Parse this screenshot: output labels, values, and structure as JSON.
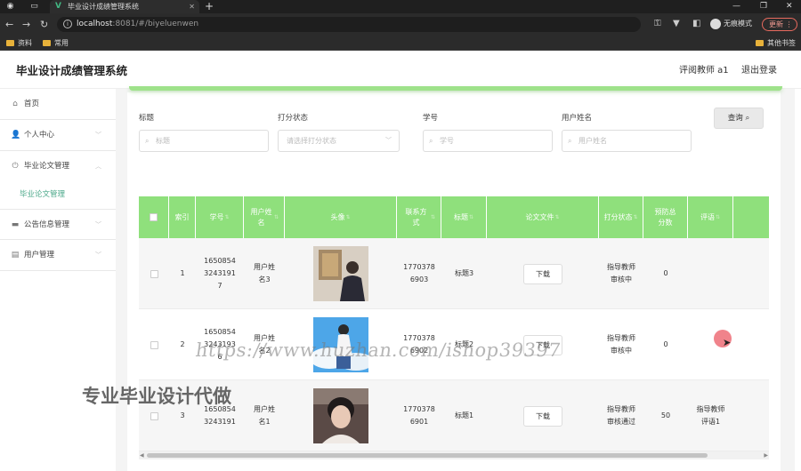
{
  "browser": {
    "tab_title": "毕业设计成绩管理系统",
    "url_host": "localhost",
    "url_rest": ":8081/#/biyeluenwen",
    "incognito_label": "无痕模式",
    "update_label": "更新",
    "bookmarks": [
      "资料",
      "常用"
    ],
    "other_bookmarks": "其他书签"
  },
  "header": {
    "title": "毕业设计成绩管理系统",
    "user": "评阅教师 a1",
    "logout": "退出登录"
  },
  "sidebar": {
    "items": [
      {
        "label": "首页",
        "icon": "home-icon"
      },
      {
        "label": "个人中心",
        "icon": "user-icon"
      },
      {
        "label": "毕业论文管理",
        "icon": "power-icon"
      },
      {
        "label": "公告信息管理",
        "icon": "monitor-icon"
      },
      {
        "label": "用户管理",
        "icon": "clipboard-icon"
      }
    ],
    "active_sub": "毕业论文管理"
  },
  "filters": {
    "title_label": "标题",
    "title_placeholder": "标题",
    "status_label": "打分状态",
    "status_placeholder": "请选择打分状态",
    "student_label": "学号",
    "student_placeholder": "学号",
    "name_label": "用户姓名",
    "name_placeholder": "用户姓名",
    "query_label": "查询"
  },
  "table": {
    "headers": [
      "索引",
      "学号",
      "用户姓名",
      "头像",
      "联系方式",
      "标题",
      "论文文件",
      "打分状态",
      "预防总分数",
      "评语"
    ],
    "download_label": "下载",
    "rows": [
      {
        "index": "1",
        "student_id": "16508543243191 7",
        "name": "用户姓名3",
        "phone": "17703786903",
        "title": "标题3",
        "status": "指导教师审核中",
        "score": "0",
        "comment": ""
      },
      {
        "index": "2",
        "student_id": "165085432431936",
        "name": "用户姓名2",
        "phone": "17703786902",
        "title": "标题2",
        "status": "指导教师审核中",
        "score": "0",
        "comment": ""
      },
      {
        "index": "3",
        "student_id": "16508543243191",
        "name": "用户姓名1",
        "phone": "17703786901",
        "title": "标题1",
        "status": "指导教师审核通过",
        "score": "50",
        "comment": "指导教师评语1"
      }
    ]
  },
  "overlay": {
    "watermark": "https://www.huzhan.com/ishop39397",
    "promo": "专业毕业设计代做"
  },
  "colors": {
    "accent_green": "#8fe07c",
    "sidebar_active": "#4ba88a"
  }
}
